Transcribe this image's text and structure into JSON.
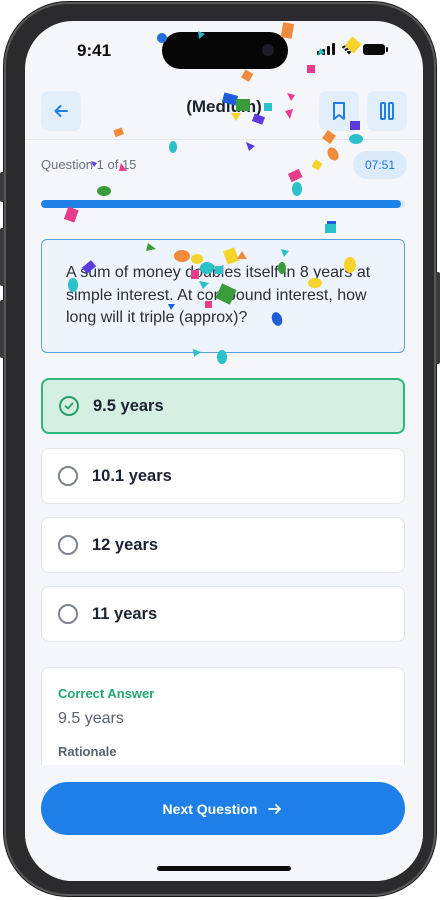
{
  "status_bar": {
    "time": "9:41",
    "icons": [
      "cellular-signal-icon",
      "wifi-icon",
      "battery-icon"
    ]
  },
  "header": {
    "title": "(Medium)",
    "back_icon": "arrow-left-icon",
    "bookmark_icon": "bookmark-icon",
    "pause_icon": "pause-icon"
  },
  "progress": {
    "label": "Question 1 of 15",
    "timer": "07:51",
    "fraction": 0.99
  },
  "question": {
    "text": "A sum of money doubles itself in 8 years at simple interest. At compound interest, how long will it triple (approx)?"
  },
  "options": [
    {
      "label": "9.5 years",
      "selected": true
    },
    {
      "label": "10.1 years",
      "selected": false
    },
    {
      "label": "12 years",
      "selected": false
    },
    {
      "label": "11 years",
      "selected": false
    }
  ],
  "answer": {
    "correct_label": "Correct Answer",
    "correct_value": "9.5 years",
    "rationale_label": "Rationale"
  },
  "next_button": {
    "label": "Next Question",
    "icon": "arrow-right-icon"
  },
  "colors": {
    "accent": "#1e7fe8",
    "correct": "#2fb67c",
    "selected_bg": "#d5f0e3",
    "question_border": "#5aa0e0"
  }
}
